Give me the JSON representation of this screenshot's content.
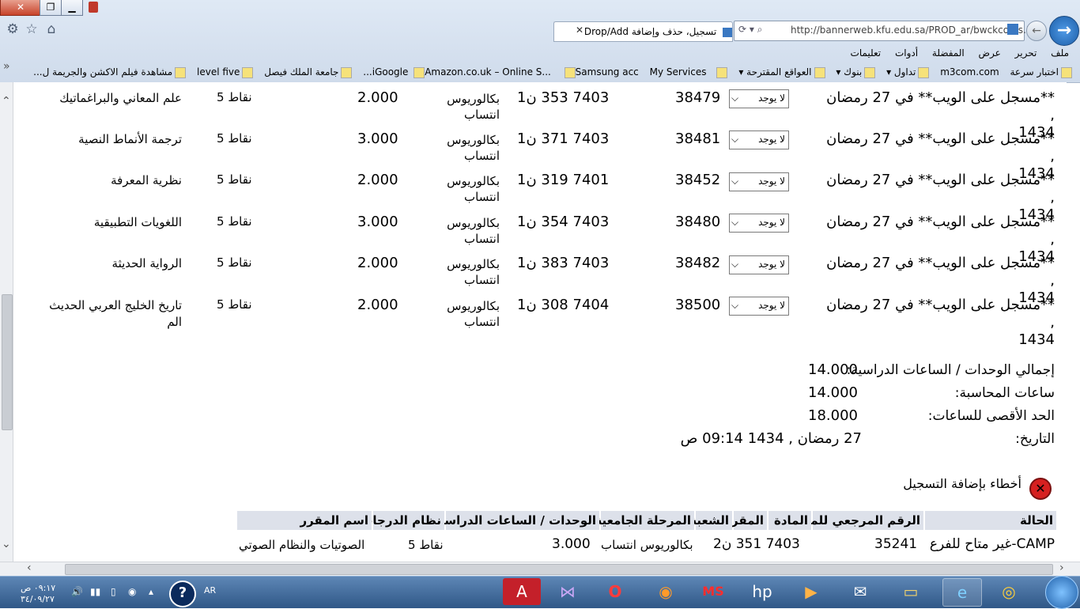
{
  "browser": {
    "tab_title": "تسجيل، حذف وإضافة Drop/Add",
    "url": "http://bannerweb.kfu.edu.sa/PROD_ar/bwckcoms.I",
    "menu": [
      "ملف",
      "تحرير",
      "عرض",
      "المفضلة",
      "أدوات",
      "تعليمات"
    ],
    "favorites": [
      "اختبار سرعة",
      "m3com.com",
      "تداول",
      "بنوك",
      "العواقع المقترحة",
      "iGoogle",
      "Amazon.co.uk – Online S...",
      "Samsung acc",
      "My Services...",
      "جامعة الملك فيصل",
      "level five",
      "مشاهدة فيلم الاكشن والجريمة ل..."
    ]
  },
  "courses": [
    {
      "status": "**مسجل على الويب** في 27 رمضان ,",
      "year": "1434",
      "select": "لا يوجد",
      "crn": "38479",
      "course": "7403 353 ن1",
      "level": "بكالوريوس",
      "level2": "انتساب",
      "credits": "2.000",
      "grading": "نقاط 5",
      "title": "علم المعاني والبراغماتيك",
      "title2": ""
    },
    {
      "status": "**مسجل على الويب** في 27 رمضان ,",
      "year": "1434",
      "select": "لا يوجد",
      "crn": "38481",
      "course": "7403 371 ن1",
      "level": "بكالوريوس",
      "level2": "انتساب",
      "credits": "3.000",
      "grading": "نقاط 5",
      "title": "ترجمة الأنماط النصية",
      "title2": ""
    },
    {
      "status": "**مسجل على الويب** في 27 رمضان ,",
      "year": "1434",
      "select": "لا يوجد",
      "crn": "38452",
      "course": "7401 319 ن1",
      "level": "بكالوريوس",
      "level2": "انتساب",
      "credits": "2.000",
      "grading": "نقاط 5",
      "title": "نظرية المعرفة",
      "title2": ""
    },
    {
      "status": "**مسجل على الويب** في 27 رمضان ,",
      "year": "1434",
      "select": "لا يوجد",
      "crn": "38480",
      "course": "7403 354 ن1",
      "level": "بكالوريوس",
      "level2": "انتساب",
      "credits": "3.000",
      "grading": "نقاط 5",
      "title": "اللغويات التطبيقية",
      "title2": ""
    },
    {
      "status": "**مسجل على الويب** في 27 رمضان ,",
      "year": "1434",
      "select": "لا يوجد",
      "crn": "38482",
      "course": "7403 383 ن1",
      "level": "بكالوريوس",
      "level2": "انتساب",
      "credits": "2.000",
      "grading": "نقاط 5",
      "title": "الرواية الحديثة",
      "title2": ""
    },
    {
      "status": "**مسجل على الويب** في 27 رمضان ,",
      "year": "1434",
      "select": "لا يوجد",
      "crn": "38500",
      "course": "7404 308 ن1",
      "level": "بكالوريوس",
      "level2": "انتساب",
      "credits": "2.000",
      "grading": "نقاط 5",
      "title": "تاريخ الخليج العربي الحديث",
      "title2": "الم"
    }
  ],
  "summary": {
    "total_label": "إجمالي الوحدات / الساعات الدراسية:",
    "total_value": "14.000",
    "billing_label": "ساعات المحاسبة:",
    "billing_value": "14.000",
    "max_label": "الحد الأقصى للساعات:",
    "max_value": "18.000",
    "date_label": "التاريخ:",
    "date_value": "27 رمضان , 1434 09:14 ص"
  },
  "errors": {
    "title": "أخطاء بإضافة التسجيل",
    "headers": {
      "status": "الحالة",
      "crn": "الرقم المرجعي للمقرر",
      "subject": "المادة",
      "course": "المقرر",
      "section": "الشعبة",
      "level": "المرحلة الجامعية",
      "credits": "الوحدات / الساعات الدراسية",
      "grading": "نظام الدرجات",
      "title": "اسم المقرر"
    },
    "row": {
      "status": "CAMP-غير متاح للفرع",
      "crn": "35241",
      "course": "7403 351 ن2",
      "level": "بكالوريوس انتساب",
      "credits": "3.000",
      "grading": "نقاط 5",
      "title": "الصوتيات والنظام الصوتي"
    }
  },
  "taskbar": {
    "time": "٠٩:١٧ ص",
    "date": "٣٤/٠٩/٢٧",
    "lang": "AR"
  }
}
